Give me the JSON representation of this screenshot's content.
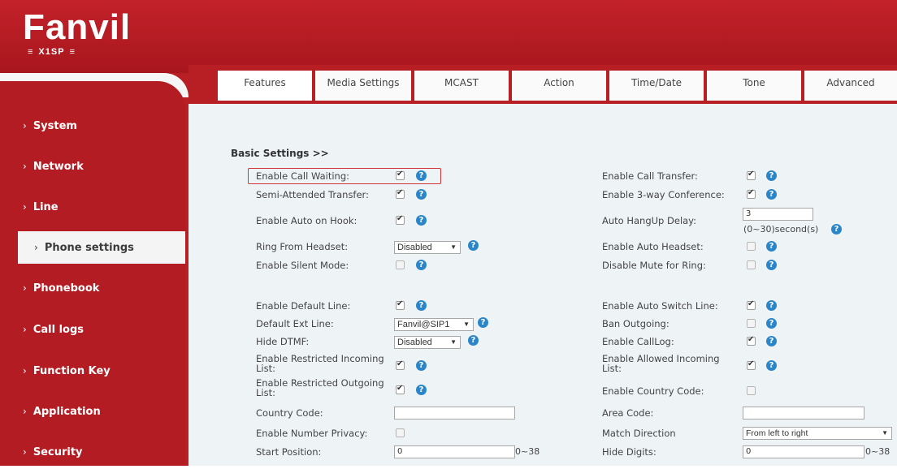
{
  "header": {
    "brand": "Fanvil",
    "model": "X1SP"
  },
  "sidebar": {
    "items": [
      {
        "label": "System"
      },
      {
        "label": "Network"
      },
      {
        "label": "Line"
      },
      {
        "label": "Phone settings",
        "active": true
      },
      {
        "label": "Phonebook"
      },
      {
        "label": "Call logs"
      },
      {
        "label": "Function Key"
      },
      {
        "label": "Application"
      },
      {
        "label": "Security"
      }
    ]
  },
  "tabs": [
    {
      "label": "Features",
      "active": true
    },
    {
      "label": "Media Settings"
    },
    {
      "label": "MCAST"
    },
    {
      "label": "Action"
    },
    {
      "label": "Time/Date"
    },
    {
      "label": "Tone"
    },
    {
      "label": "Advanced"
    }
  ],
  "section": {
    "title": "Basic Settings >>"
  },
  "help_glyph": "?",
  "fields": {
    "enable_call_waiting": {
      "label": "Enable Call Waiting:",
      "checked": true
    },
    "semi_attended_transfer": {
      "label": "Semi-Attended Transfer:",
      "checked": true
    },
    "enable_auto_on_hook": {
      "label": "Enable Auto on Hook:",
      "checked": true
    },
    "ring_from_headset": {
      "label": "Ring From Headset:",
      "value": "Disabled"
    },
    "enable_silent_mode": {
      "label": "Enable Silent Mode:",
      "checked": false
    },
    "enable_default_line": {
      "label": "Enable Default Line:",
      "checked": true
    },
    "default_ext_line": {
      "label": "Default Ext Line:",
      "value": "Fanvil@SIP1"
    },
    "hide_dtmf": {
      "label": "Hide DTMF:",
      "value": "Disabled"
    },
    "enable_restricted_incoming": {
      "label": "Enable Restricted Incoming List:",
      "checked": true
    },
    "enable_restricted_outgoing": {
      "label": "Enable Restricted Outgoing List:",
      "checked": true
    },
    "country_code": {
      "label": "Country Code:",
      "value": ""
    },
    "enable_number_privacy": {
      "label": "Enable Number Privacy:",
      "checked": false
    },
    "start_position": {
      "label": "Start Position:",
      "value": "0",
      "range": "0~38"
    },
    "enable_call_transfer": {
      "label": "Enable Call Transfer:",
      "checked": true
    },
    "enable_3way_conference": {
      "label": "Enable 3-way Conference:",
      "checked": true
    },
    "auto_hangup_delay": {
      "label": "Auto HangUp Delay:",
      "value": "3",
      "hint": "(0~30)second(s)"
    },
    "enable_auto_headset": {
      "label": "Enable Auto Headset:",
      "checked": false
    },
    "disable_mute_for_ring": {
      "label": "Disable Mute for Ring:",
      "checked": false
    },
    "enable_auto_switch_line": {
      "label": "Enable Auto Switch Line:",
      "checked": true
    },
    "ban_outgoing": {
      "label": "Ban Outgoing:",
      "checked": false
    },
    "enable_calllog": {
      "label": "Enable CallLog:",
      "checked": true
    },
    "enable_allowed_incoming": {
      "label": "Enable Allowed Incoming List:",
      "checked": true
    },
    "enable_country_code": {
      "label": "Enable Country Code:",
      "checked": false
    },
    "area_code": {
      "label": "Area Code:",
      "value": ""
    },
    "match_direction": {
      "label": "Match Direction",
      "value": "From left to right"
    },
    "hide_digits": {
      "label": "Hide Digits:",
      "value": "0",
      "range": "0~38"
    }
  }
}
